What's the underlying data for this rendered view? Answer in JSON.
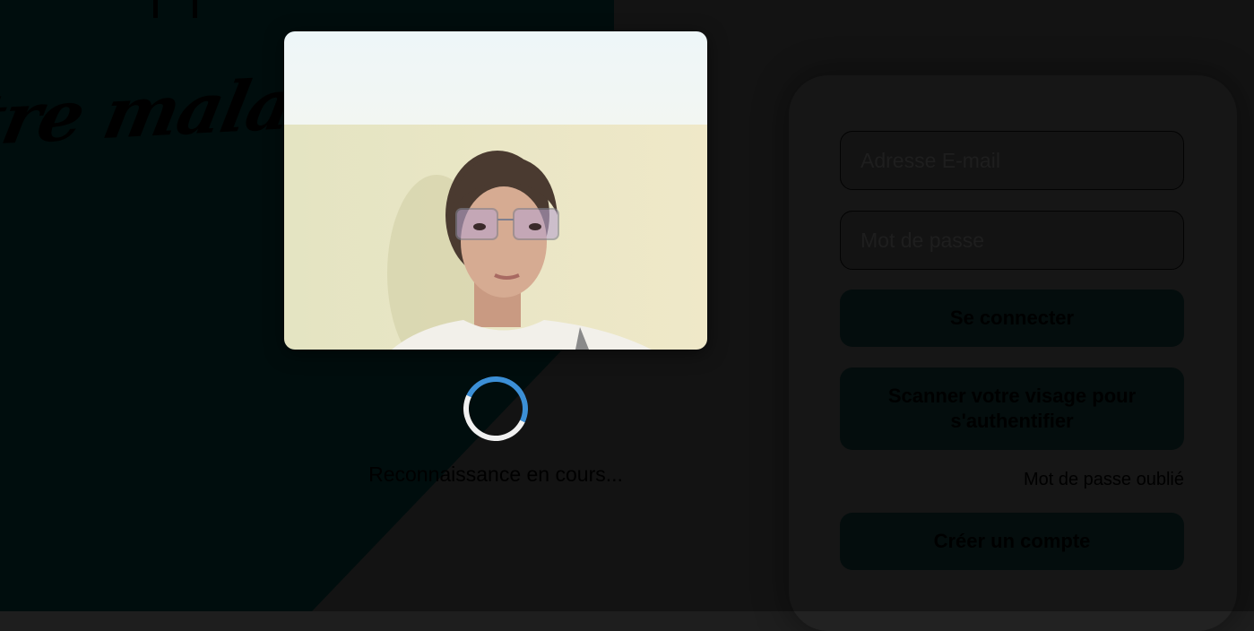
{
  "background": {
    "tagline": "tre malade",
    "colors": {
      "dark_teal": "#011514",
      "dark_gray": "#1e1e1e"
    }
  },
  "login": {
    "email_placeholder": "Adresse E-mail",
    "password_placeholder": "Mot de passe",
    "login_button": "Se connecter",
    "face_scan_button": "Scanner votre visage pour s'authentifier",
    "forgot_password": "Mot de passe oublié",
    "create_account_button": "Créer un compte"
  },
  "face_modal": {
    "status": "Reconnaissance en cours...",
    "spinner_color": "#3c8fd6"
  }
}
